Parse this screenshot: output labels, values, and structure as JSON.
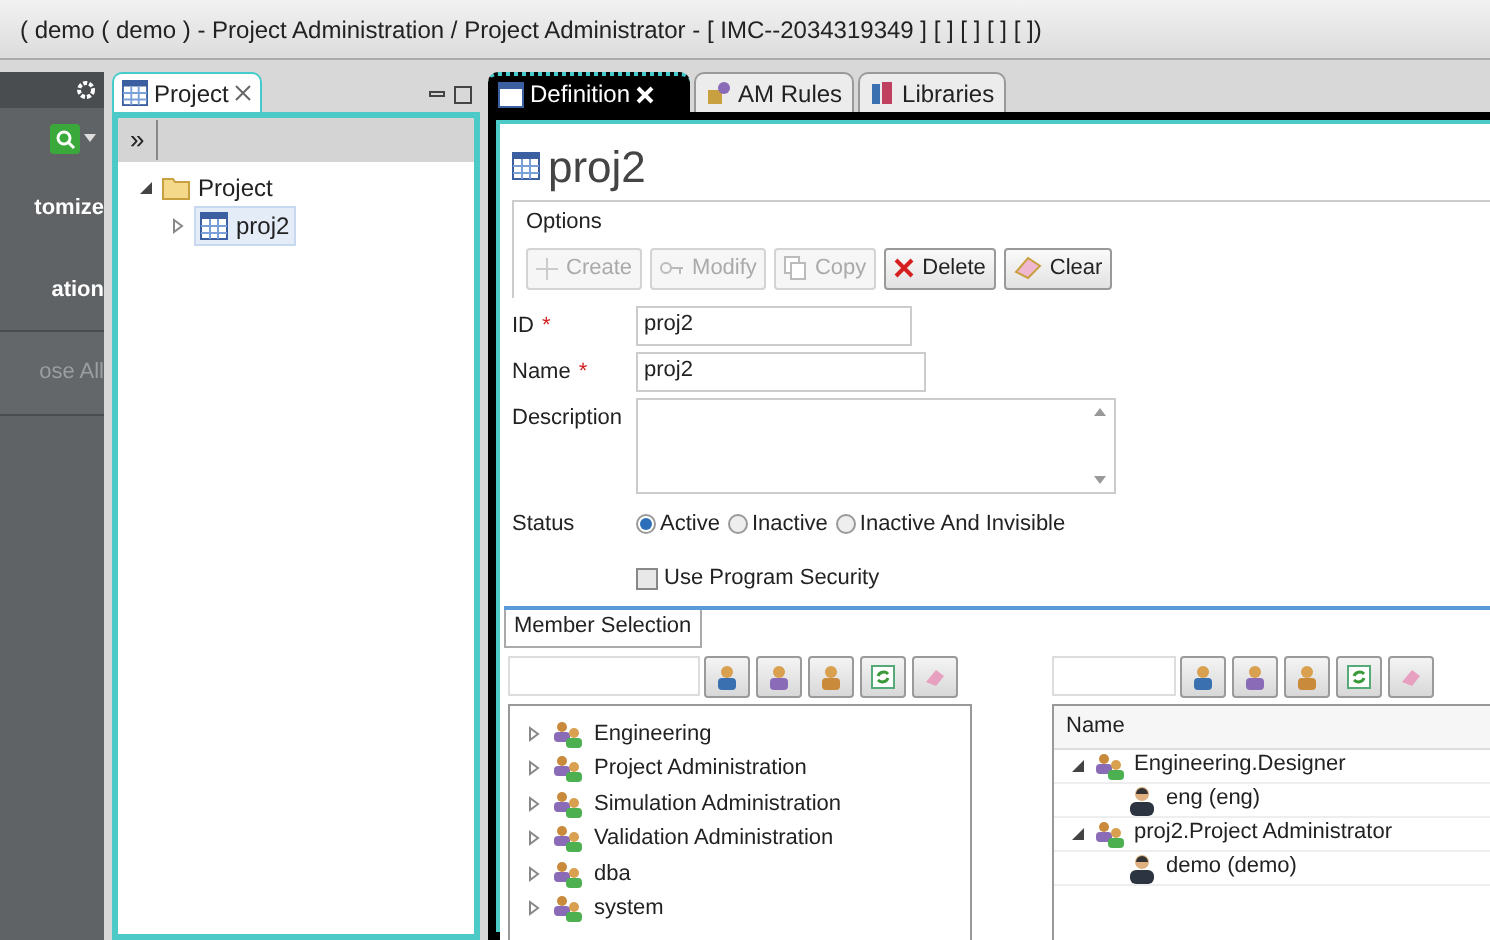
{
  "window": {
    "title": "( demo ( demo ) - Project Administration / Project Administrator - [ IMC--2034319349 ] [ ] [ ] [ ]  [  ])"
  },
  "left_panel": {
    "items": [
      {
        "label": "tomize",
        "disabled": false
      },
      {
        "label": "ation",
        "disabled": false
      },
      {
        "label": "ose All",
        "disabled": true
      }
    ]
  },
  "project_view": {
    "tab": {
      "label": "Project",
      "closable": true
    },
    "toolbar_label": "»",
    "tree": [
      {
        "label": "Project",
        "kind": "folder",
        "expanded": true,
        "selected": false,
        "children": [
          {
            "label": "proj2",
            "kind": "project",
            "expanded": false,
            "selected": true
          }
        ]
      }
    ]
  },
  "editor": {
    "tabs": [
      {
        "label": "Definition",
        "selected": true,
        "closable": true
      },
      {
        "label": "AM Rules",
        "selected": false,
        "closable": false
      },
      {
        "label": "Libraries",
        "selected": false,
        "closable": false
      }
    ],
    "title": "proj2",
    "options": {
      "label": "Options",
      "buttons": [
        {
          "label": "Create",
          "kind": "create",
          "disabled": true
        },
        {
          "label": "Modify",
          "kind": "modify",
          "disabled": true
        },
        {
          "label": "Copy",
          "kind": "copy",
          "disabled": true
        },
        {
          "label": "Delete",
          "kind": "delete",
          "disabled": false
        },
        {
          "label": "Clear",
          "kind": "clear",
          "disabled": false
        }
      ]
    },
    "fields": [
      {
        "label": "ID",
        "marker": "*",
        "value": "proj2",
        "kind": "text"
      },
      {
        "label": "Name",
        "marker": "*",
        "value": "proj2",
        "kind": "text"
      },
      {
        "label": "Description",
        "kind": "textarea"
      }
    ],
    "status": {
      "label": "Status",
      "options": [
        {
          "label": "Active",
          "selected": true
        },
        {
          "label": "Inactive",
          "selected": false
        },
        {
          "label": "Inactive And Invisible",
          "selected": false
        }
      ]
    },
    "use_program_security": {
      "label": "Use Program Security",
      "checked": false
    },
    "member_selection": {
      "tab": {
        "label": "Member Selection",
        "selected": true
      },
      "available": [
        {
          "label": "Engineering",
          "expanded": false
        },
        {
          "label": "Project Administration",
          "expanded": false
        },
        {
          "label": "Simulation Administration",
          "expanded": false
        },
        {
          "label": "Validation Administration",
          "expanded": false
        },
        {
          "label": "dba",
          "expanded": false
        },
        {
          "label": "system",
          "expanded": false
        }
      ],
      "selected_table": {
        "columns": [
          "Name"
        ],
        "rows": [
          {
            "label": "Engineering.Designer",
            "kind": "group",
            "expanded": true,
            "children": [
              {
                "label": "eng (eng)",
                "kind": "user"
              }
            ]
          },
          {
            "label": "proj2.Project Administrator",
            "kind": "group",
            "expanded": true,
            "children": [
              {
                "label": "demo  (demo)",
                "kind": "user"
              }
            ]
          }
        ]
      }
    }
  }
}
